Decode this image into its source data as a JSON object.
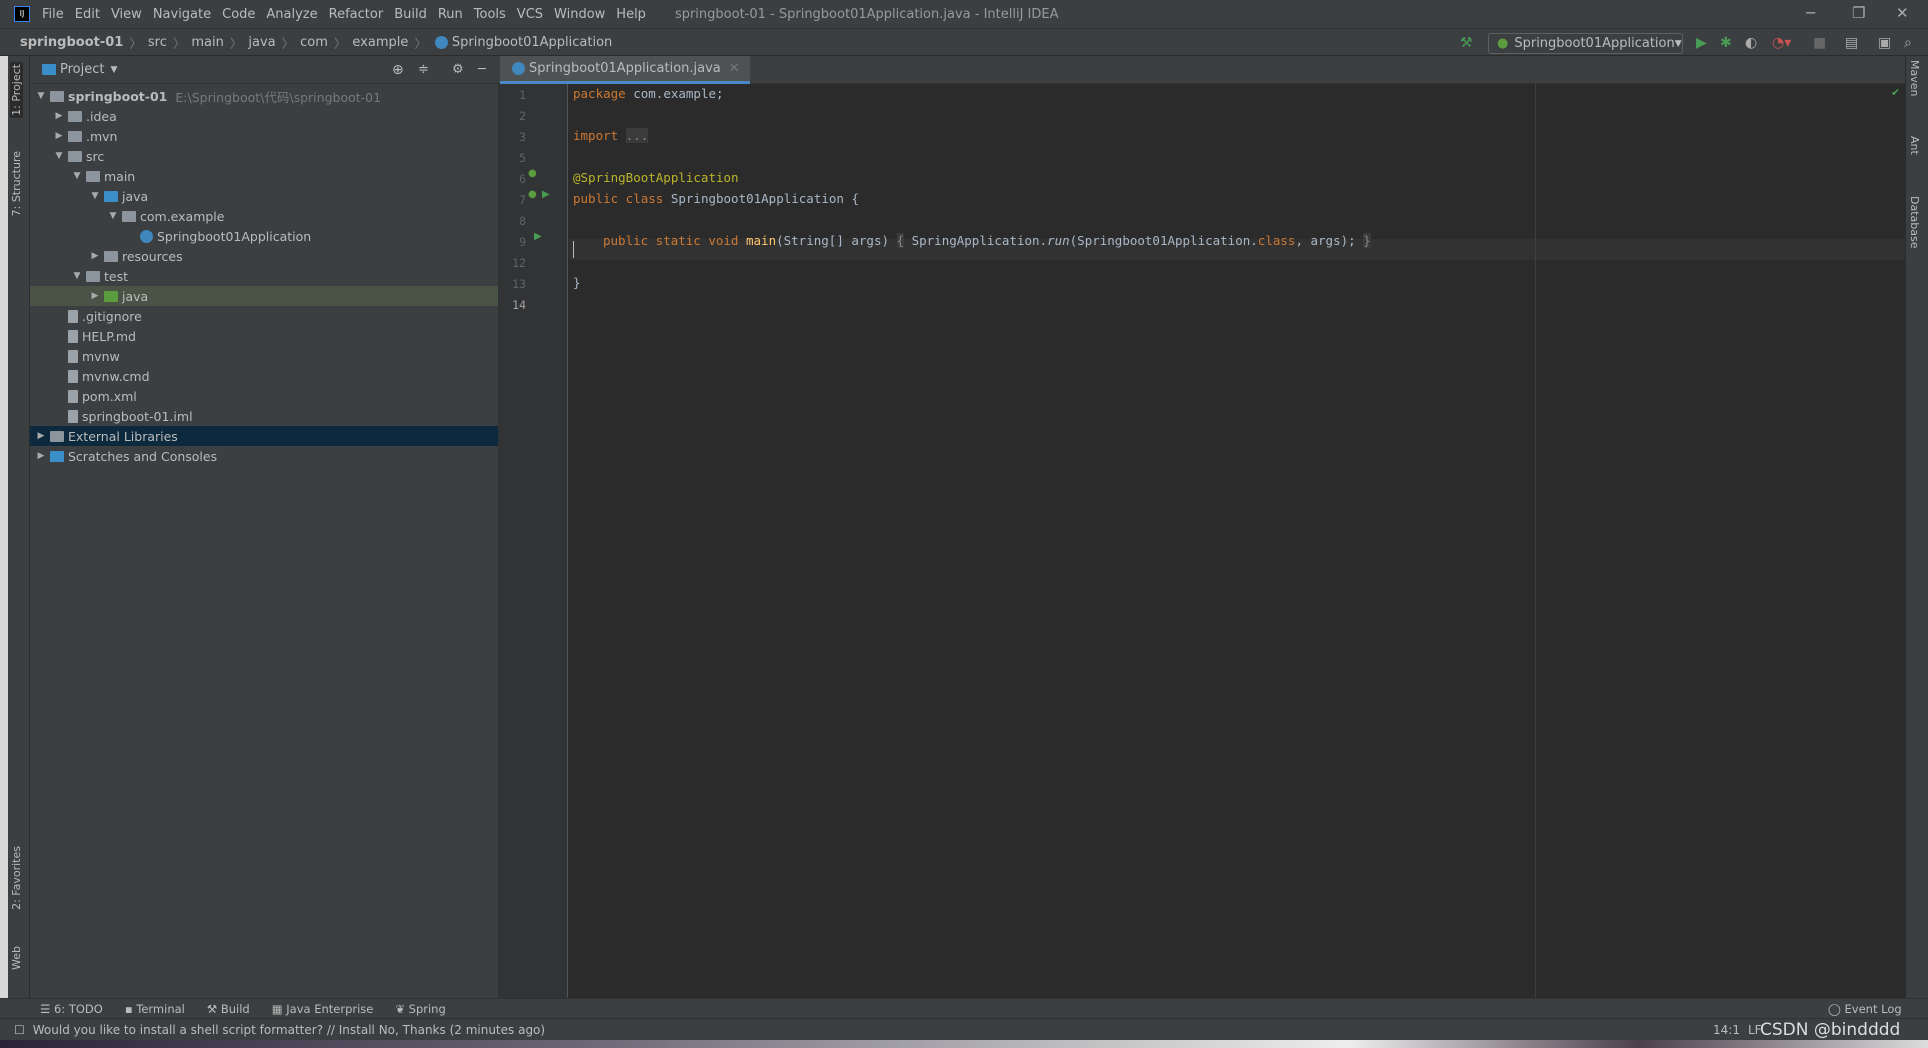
{
  "menubar": {
    "logo": "IJ",
    "items": [
      "File",
      "Edit",
      "View",
      "Navigate",
      "Code",
      "Analyze",
      "Refactor",
      "Build",
      "Run",
      "Tools",
      "VCS",
      "Window",
      "Help"
    ],
    "title": "springboot-01 - Springboot01Application.java - IntelliJ IDEA"
  },
  "breadcrumb": [
    "springboot-01",
    "src",
    "main",
    "java",
    "com",
    "example",
    "Springboot01Application"
  ],
  "run_config": "Springboot01Application",
  "left_strip": [
    "1: Project",
    "7: Structure",
    "2: Favorites",
    "Web"
  ],
  "right_strip": [
    "Maven",
    "Ant",
    "Database"
  ],
  "project": {
    "header": "Project",
    "tree": [
      {
        "label": "springboot-01",
        "path": "E:\\Springboot\\代码\\springboot-01",
        "depth": 0,
        "arrow": "open",
        "icon": "module-folder"
      },
      {
        "label": ".idea",
        "depth": 1,
        "arrow": "closed",
        "icon": "folder"
      },
      {
        "label": ".mvn",
        "depth": 1,
        "arrow": "closed",
        "icon": "folder"
      },
      {
        "label": "src",
        "depth": 1,
        "arrow": "open",
        "icon": "folder"
      },
      {
        "label": "main",
        "depth": 2,
        "arrow": "open",
        "icon": "folder"
      },
      {
        "label": "java",
        "depth": 3,
        "arrow": "open",
        "icon": "source-folder"
      },
      {
        "label": "com.example",
        "depth": 4,
        "arrow": "open",
        "icon": "package"
      },
      {
        "label": "Springboot01Application",
        "depth": 5,
        "arrow": "none",
        "icon": "spring-class"
      },
      {
        "label": "resources",
        "depth": 3,
        "arrow": "closed",
        "icon": "resources-folder"
      },
      {
        "label": "test",
        "depth": 2,
        "arrow": "open",
        "icon": "folder"
      },
      {
        "label": "java",
        "depth": 3,
        "arrow": "closed",
        "icon": "test-folder",
        "selected": true
      },
      {
        "label": ".gitignore",
        "depth": 1,
        "arrow": "none",
        "icon": "file"
      },
      {
        "label": "HELP.md",
        "depth": 1,
        "arrow": "none",
        "icon": "markdown-file"
      },
      {
        "label": "mvnw",
        "depth": 1,
        "arrow": "none",
        "icon": "script-file"
      },
      {
        "label": "mvnw.cmd",
        "depth": 1,
        "arrow": "none",
        "icon": "file"
      },
      {
        "label": "pom.xml",
        "depth": 1,
        "arrow": "none",
        "icon": "maven-file"
      },
      {
        "label": "springboot-01.iml",
        "depth": 1,
        "arrow": "none",
        "icon": "file"
      },
      {
        "label": "External Libraries",
        "depth": 0,
        "arrow": "closed",
        "icon": "libraries",
        "focused": true
      },
      {
        "label": "Scratches and Consoles",
        "depth": 0,
        "arrow": "closed",
        "icon": "scratches"
      }
    ]
  },
  "editor": {
    "tab": "Springboot01Application.java",
    "line_numbers": [
      "1",
      "2",
      "3",
      "5",
      "6",
      "7",
      "8",
      "9",
      "12",
      "13",
      "14"
    ],
    "code": {
      "l1a": "package",
      "l1b": " com.example;",
      "l3a": "import",
      "l3b": "...",
      "l6": "@SpringBootApplication",
      "l7a": "public class",
      "l7b": " Springboot01Application {",
      "l9a": "public static void",
      "l9b": "main",
      "l9c": "(String[] args)",
      "l9d": "{",
      "l9e": " SpringApplication.",
      "l9f": "run",
      "l9g": "(Springboot01Application.",
      "l9h": "class",
      "l9i": ", args);",
      "l9j": "}",
      "l13": "}"
    }
  },
  "bottom_tools": [
    "6: TODO",
    "Terminal",
    "Build",
    "Java Enterprise",
    "Spring"
  ],
  "event_log": "Event Log",
  "status": {
    "message": "Would you like to install a shell script formatter? // Install   No, Thanks (2 minutes ago)",
    "position": "14:1",
    "line_sep": "LF",
    "watermark": "CSDN @bindddd"
  }
}
